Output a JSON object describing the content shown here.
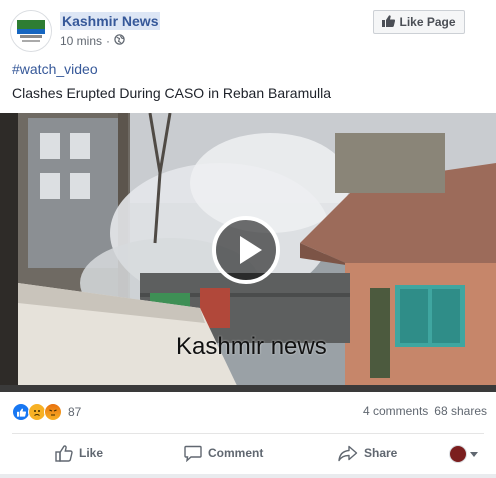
{
  "post": {
    "page_name": "Kashmir News",
    "time": "10 mins",
    "audience_icon": "globe-icon",
    "hashtag": "#watch_video",
    "caption": "Clashes Erupted During CASO in Reban Baramulla"
  },
  "header": {
    "like_page_label": "Like Page",
    "like_page_icon": "thumbs-up-icon"
  },
  "video": {
    "watermark": "Kashmir news",
    "play_icon": "play-icon"
  },
  "stats": {
    "reaction_icons": [
      "like-reaction-icon",
      "sad-reaction-icon",
      "angry-reaction-icon"
    ],
    "reaction_count": "87",
    "comments": "4 comments",
    "shares": "68 shares"
  },
  "actions": {
    "like_label": "Like",
    "comment_label": "Comment",
    "share_label": "Share"
  },
  "colors": {
    "link": "#365899",
    "text": "#1d2129",
    "muted": "#606770"
  }
}
